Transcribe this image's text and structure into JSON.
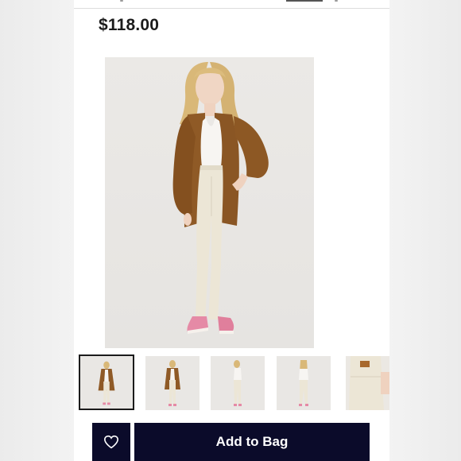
{
  "product": {
    "price": "$118.00",
    "main_image_icon": "model-photo-front",
    "thumbnails": [
      {
        "icon": "model-photo-front",
        "selected": true
      },
      {
        "icon": "model-photo-front-full",
        "selected": false
      },
      {
        "icon": "model-photo-side",
        "selected": false
      },
      {
        "icon": "model-photo-back",
        "selected": false
      },
      {
        "icon": "jeans-back-closeup",
        "selected": false
      }
    ]
  },
  "actions": {
    "favorite_icon": "heart-icon",
    "add_to_bag_label": "Add to Bag"
  },
  "colors": {
    "button_bg": "#0b0b2a",
    "price_text": "#1b1b1b",
    "shirt": "#8f5a26",
    "jeans": "#ece6d6",
    "shoes": "#e58aa6"
  }
}
